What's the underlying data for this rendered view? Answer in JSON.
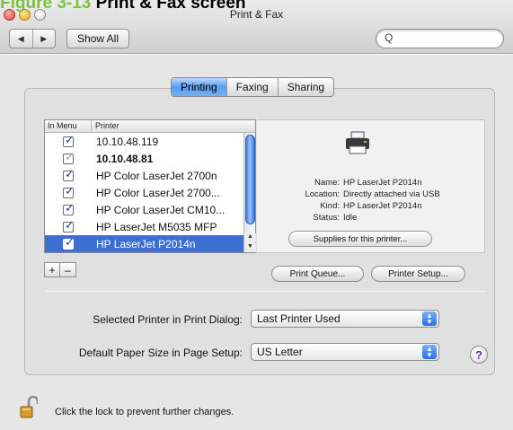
{
  "caption": {
    "figure": "Figure 3-13",
    "title": "Print & Fax screen"
  },
  "window": {
    "title": "Print & Fax"
  },
  "toolbar": {
    "back_glyph": "◀",
    "forward_glyph": "▶",
    "show_all_label": "Show All",
    "search_placeholder": "",
    "search_glyph": "Q"
  },
  "tabs": [
    {
      "label": "Printing",
      "active": true
    },
    {
      "label": "Faxing",
      "active": false
    },
    {
      "label": "Sharing",
      "active": false
    }
  ],
  "printer_list": {
    "columns": [
      "In Menu",
      "Printer"
    ],
    "rows": [
      {
        "name": "10.10.48.119",
        "in_menu": true,
        "bold": false,
        "dim": false,
        "selected": false
      },
      {
        "name": "10.10.48.81",
        "in_menu": true,
        "bold": true,
        "dim": true,
        "selected": false
      },
      {
        "name": "HP Color LaserJet 2700n",
        "in_menu": true,
        "bold": false,
        "dim": false,
        "selected": false
      },
      {
        "name": "HP Color LaserJet 2700...",
        "in_menu": true,
        "bold": false,
        "dim": false,
        "selected": false
      },
      {
        "name": "HP Color LaserJet CM10...",
        "in_menu": true,
        "bold": false,
        "dim": false,
        "selected": false
      },
      {
        "name": "HP LaserJet M5035 MFP",
        "in_menu": true,
        "bold": false,
        "dim": false,
        "selected": false
      },
      {
        "name": "HP LaserJet P2014n",
        "in_menu": true,
        "bold": false,
        "dim": false,
        "selected": true
      }
    ],
    "add_label": "+",
    "remove_label": "–"
  },
  "details": {
    "rows": [
      {
        "key": "Name:",
        "value": "HP LaserJet P2014n"
      },
      {
        "key": "Location:",
        "value": "Directly attached via USB"
      },
      {
        "key": "Kind:",
        "value": "HP LaserJet P2014n"
      },
      {
        "key": "Status:",
        "value": "Idle"
      }
    ],
    "supplies_label": "Supplies for this printer..."
  },
  "buttons": {
    "print_queue": "Print Queue...",
    "printer_setup": "Printer Setup..."
  },
  "selected_printer": {
    "label": "Selected Printer in Print Dialog:",
    "value": "Last Printer Used"
  },
  "paper_size": {
    "label": "Default Paper Size in Page Setup:",
    "value": "US Letter"
  },
  "help_label": "?",
  "lock_text": "Click the lock to prevent further changes.",
  "colors": {
    "accent": "#3d6fd3",
    "caption_green": "#7cc242"
  }
}
